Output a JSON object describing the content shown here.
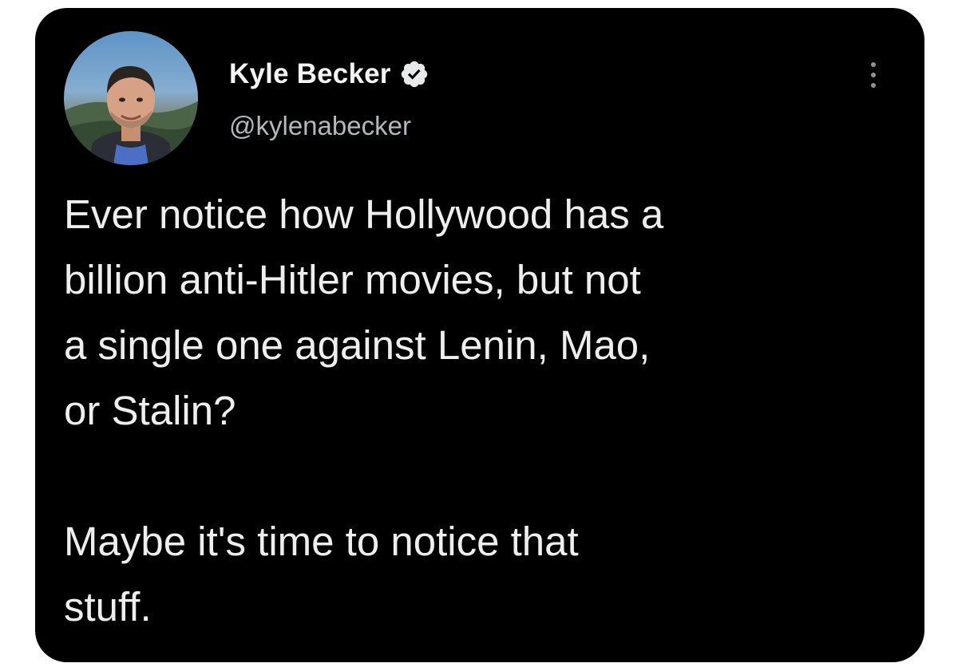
{
  "tweet": {
    "author": {
      "display_name": "Kyle Becker",
      "handle": "@kylenabecker",
      "verified": true,
      "avatar_icon": "profile-photo"
    },
    "more_icon": "more-options-icon",
    "text": {
      "paragraph_1_lines": [
        "Ever notice how Hollywood has a",
        "billion anti-Hitler movies, but not",
        "a single one against Lenin, Mao,",
        "or Stalin?"
      ],
      "paragraph_2_lines": [
        "Maybe it's time to notice that",
        "stuff."
      ]
    }
  },
  "colors": {
    "page_background": "#ffffff",
    "card_background": "#000000",
    "primary_text": "#eeeeee",
    "secondary_text": "#b4b7bb",
    "verified_badge": "#e7e9ea"
  }
}
